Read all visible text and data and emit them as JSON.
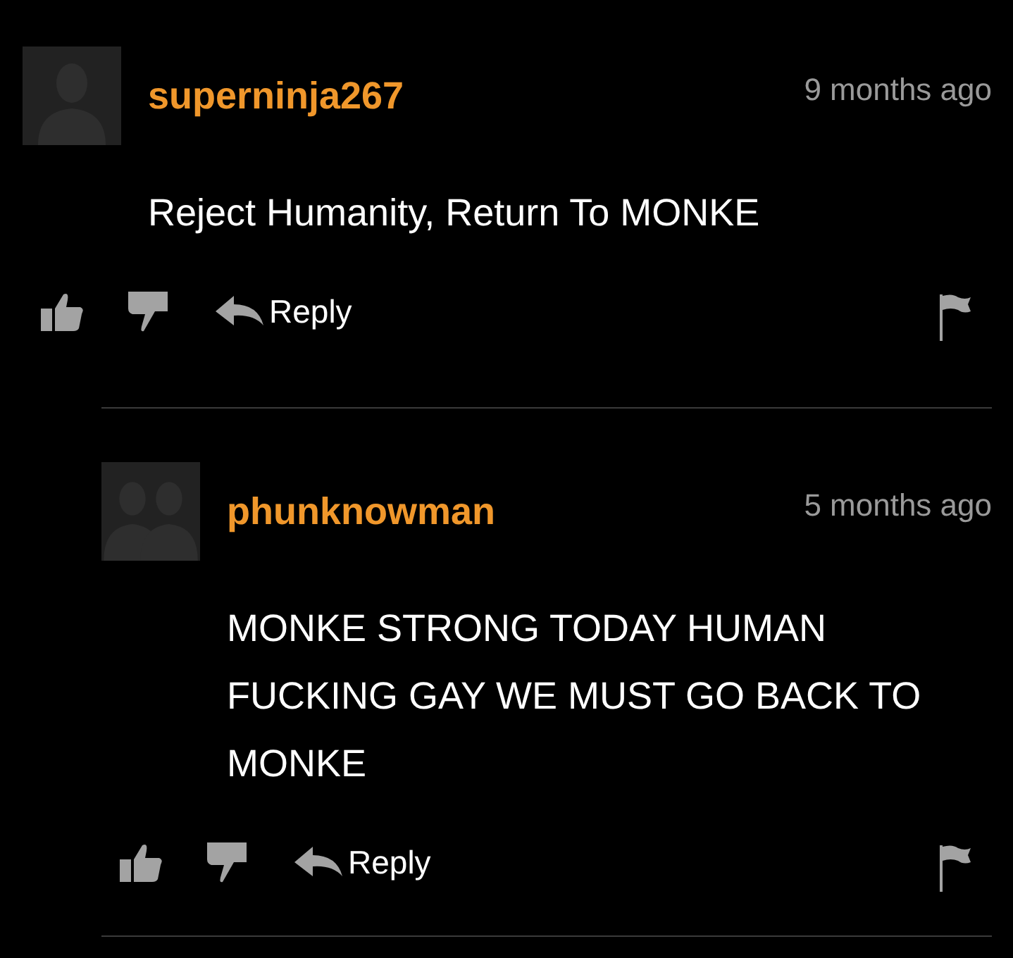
{
  "comments": [
    {
      "avatar": {
        "kind": "single"
      },
      "username": "superninja267",
      "time": "9 months ago",
      "body": "Reject Humanity, Return To MONKE",
      "reply_label": "Reply",
      "children": [
        {
          "avatar": {
            "kind": "pair"
          },
          "username": "phunknowman",
          "time": "5 months ago",
          "body": "MONKE STRONG TODAY HUMAN FUCKING GAY WE MUST GO BACK TO MONKE",
          "reply_label": "Reply"
        }
      ]
    }
  ]
}
